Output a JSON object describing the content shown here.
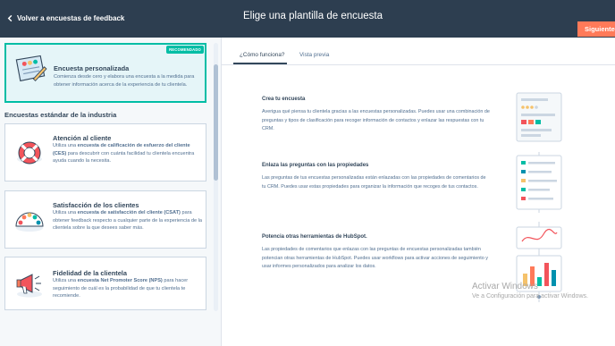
{
  "header": {
    "back_label": "Volver a encuestas de feedback",
    "title": "Elige una plantilla de encuesta",
    "next_label": "Siguiente"
  },
  "sidebar": {
    "custom": {
      "title": "Encuesta personalizada",
      "description": "Comienza desde cero y elabora una encuesta a la medida para obtener información acerca de la experiencia de tu clientela.",
      "badge": "RECOMENDADO"
    },
    "section_heading": "Encuestas estándar de la industria",
    "templates": [
      {
        "title": "Atención al cliente",
        "desc_pre": "Utiliza una ",
        "desc_bold": "encuesta de calificación de esfuerzo del cliente (CES)",
        "desc_post": " para descubrir con cuánta facilidad tu clientela encuentra ayuda cuando la necesita."
      },
      {
        "title": "Satisfacción de los clientes",
        "desc_pre": "Utiliza una ",
        "desc_bold": "encuesta de satisfacción del cliente (CSAT)",
        "desc_post": " para obtener feedback respecto a cualquier parte de la experiencia de la clientela sobre la que desees saber más."
      },
      {
        "title": "Fidelidad de la clientela",
        "desc_pre": "Utiliza una ",
        "desc_bold": "encuesta Net Promoter Score (NPS)",
        "desc_post": " para hacer seguimiento de cuál es la probabilidad de que tu clientela te recomiende."
      }
    ]
  },
  "tabs": [
    {
      "label": "¿Cómo funciona?",
      "active": true
    },
    {
      "label": "Vista previa",
      "active": false
    }
  ],
  "steps": [
    {
      "title": "Crea tu encuesta",
      "text": "Averigua qué piensa tu clientela gracias a las encuestas personalizadas. Puedes usar una combinación de preguntas y tipos de clasificación para recoger información de contactos y enlazar las respuestas con tu CRM."
    },
    {
      "title": "Enlaza las preguntas con las propiedades",
      "text": "Las preguntas de tus encuestas personalizadas están enlazadas con las propiedades de comentarios de tu CRM. Puedes usar estas propiedades para organizar la información que recoges de tus contactos."
    },
    {
      "title": "Potencia otras herramientas de HubSpot.",
      "text": "Las propiedades de comentarios que enlazas con las preguntas de encuestas personalizadas también potencian otras herramientas de HubSpot. Puedes usar workflows para activar acciones de seguimiento y usar informes personalizados para analizar los datos."
    }
  ],
  "watermark": {
    "line1": "Activar Windows",
    "line2": "Ve a Configuración para activar Windows."
  },
  "colors": {
    "header_bg": "#2d3e50",
    "accent": "#ff7a59",
    "teal": "#00bda5",
    "selected_bg": "#e5f5f8"
  }
}
